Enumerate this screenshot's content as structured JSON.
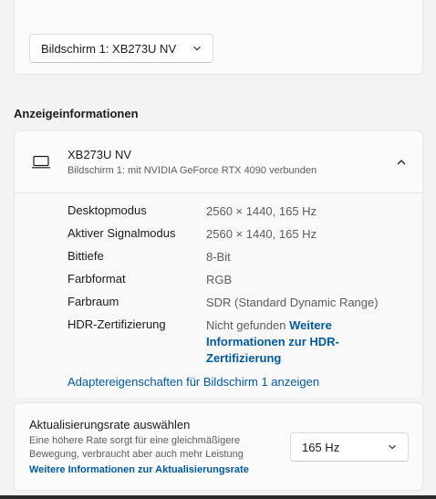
{
  "top": {
    "display_select": "Bildschirm 1: XB273U NV"
  },
  "section_title": "Anzeigeinformationen",
  "monitor": {
    "name": "XB273U NV",
    "subtitle": "Bildschirm 1: mit NVIDIA GeForce RTX 4090 verbunden",
    "icon": "monitor-icon",
    "toggle_icon": "chevron-up-icon"
  },
  "details": [
    {
      "label": "Desktopmodus",
      "value": "2560 × 1440, 165 Hz"
    },
    {
      "label": "Aktiver Signalmodus",
      "value": "2560 × 1440, 165 Hz"
    },
    {
      "label": "Bittiefe",
      "value": "8-Bit"
    },
    {
      "label": "Farbformat",
      "value": "RGB"
    },
    {
      "label": "Farbraum",
      "value": "SDR (Standard Dynamic Range)"
    },
    {
      "label": "HDR-Zertifizierung",
      "value": "Nicht gefunden",
      "link": "Weitere Informationen zur HDR-Zertifizierung"
    }
  ],
  "adapter_link": "Adaptereigenschaften für Bildschirm 1 anzeigen",
  "refresh": {
    "title": "Aktualisierungsrate auswählen",
    "description": "Eine höhere Rate sorgt für eine gleichmäßigere Bewegung, verbraucht aber auch mehr Leistung",
    "link": "Weitere Informationen zur Aktualisierungsrate",
    "selected": "165 Hz"
  },
  "colors": {
    "accent_link": "#005a9e",
    "background": "#f3f3f3",
    "card": "#fbfbfb"
  }
}
